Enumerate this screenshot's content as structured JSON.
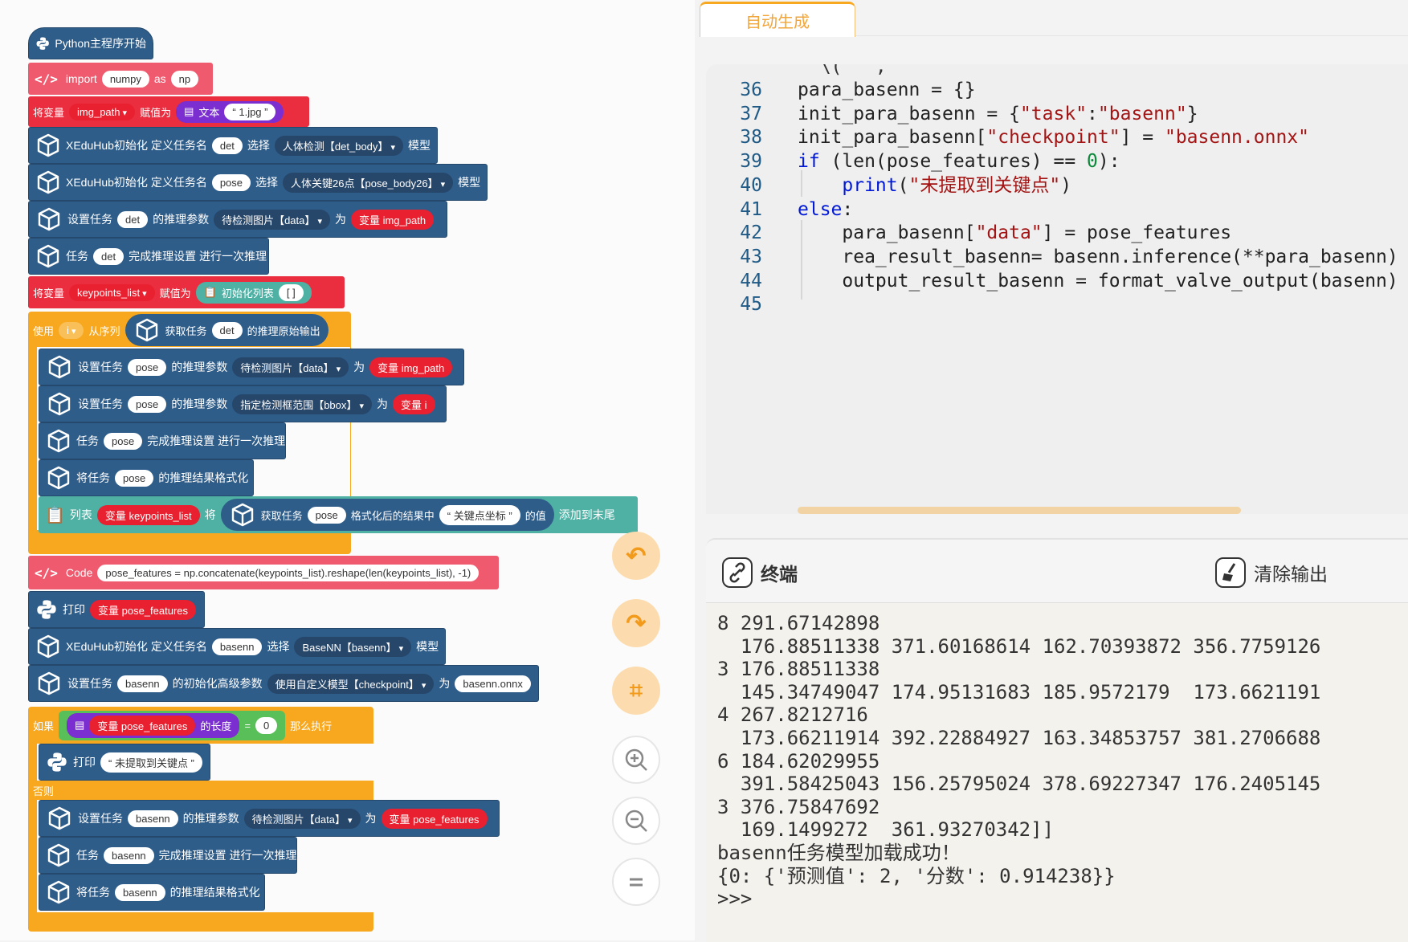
{
  "blocks": {
    "python_start": "Python主程序开始",
    "import": {
      "kw": "import",
      "module": "numpy",
      "as": "as",
      "alias": "np"
    },
    "assign_img": {
      "label1": "将变量",
      "var": "img_path",
      "label2": "赋值为",
      "text_label": "文本",
      "value": "“ 1.jpg ”"
    },
    "init_det": {
      "label": "XEduHub初始化 定义任务名",
      "name": "det",
      "select": "选择",
      "model": "人体检测【det_body】",
      "model_label": "模型"
    },
    "init_pose": {
      "label": "XEduHub初始化 定义任务名",
      "name": "pose",
      "select": "选择",
      "model": "人体关键26点【pose_body26】",
      "model_label": "模型"
    },
    "set_det": {
      "label1": "设置任务",
      "name": "det",
      "label2": "的推理参数",
      "param": "待检测图片【data】",
      "label3": "为",
      "value": "变量 img_path"
    },
    "run_det": {
      "label1": "任务",
      "name": "det",
      "label2": "完成推理设置 进行一次推理"
    },
    "assign_kp": {
      "label1": "将变量",
      "var": "keypoints_list",
      "label2": "赋值为",
      "init": "初始化列表",
      "value": "[ ]"
    },
    "loop": {
      "use": "使用",
      "var": "i",
      "from": "从序列",
      "label1": "获取任务",
      "name": "det",
      "label2": "的推理原始输出"
    },
    "set_pose_data": {
      "label1": "设置任务",
      "name": "pose",
      "label2": "的推理参数",
      "param": "待检测图片【data】",
      "label3": "为",
      "value": "变量 img_path"
    },
    "set_pose_bbox": {
      "label1": "设置任务",
      "name": "pose",
      "label2": "的推理参数",
      "param": "指定检测框范围【bbox】",
      "label3": "为",
      "value": "变量 i"
    },
    "run_pose": {
      "label1": "任务",
      "name": "pose",
      "label2": "完成推理设置 进行一次推理"
    },
    "format_pose": {
      "label1": "将任务",
      "name": "pose",
      "label2": "的推理结果格式化"
    },
    "append": {
      "list": "列表",
      "var": "变量 keypoints_list",
      "will": "将",
      "label1": "获取任务",
      "name": "pose",
      "label2": "格式化后的结果中",
      "key": "“ 关键点坐标 ”",
      "label3": "的值",
      "label4": "添加到末尾"
    },
    "code": {
      "kw": "Code",
      "text": "pose_features = np.concatenate(keypoints_list).reshape(len(keypoints_list), -1)"
    },
    "print_pf": {
      "label": "打印",
      "value": "变量 pose_features"
    },
    "init_basenn": {
      "label": "XEduHub初始化 定义任务名",
      "name": "basenn",
      "select": "选择",
      "model": "BaseNN【basenn】",
      "model_label": "模型"
    },
    "set_basenn_ckpt": {
      "label1": "设置任务",
      "name": "basenn",
      "label2": "的初始化高级参数",
      "param": "使用自定义模型【checkpoint】",
      "label3": "为",
      "value": "basenn.onnx"
    },
    "if": {
      "label": "如果",
      "var": "变量 pose_features",
      "len": "的长度",
      "eq": "=",
      "value": "0",
      "then": "那么执行"
    },
    "print_none": {
      "label": "打印",
      "value": "“ 未提取到关键点 ”"
    },
    "else": "否则",
    "set_basenn_data": {
      "label1": "设置任务",
      "name": "basenn",
      "label2": "的推理参数",
      "param": "待检测图片【data】",
      "label3": "为",
      "value": "变量 pose_features"
    },
    "run_basenn": {
      "label1": "任务",
      "name": "basenn",
      "label2": "完成推理设置 进行一次推理"
    },
    "format_basenn": {
      "label1": "将任务",
      "name": "basenn",
      "label2": "的推理结果格式化"
    }
  },
  "tab": {
    "label": "自动生成"
  },
  "code_lines": [
    {
      "n": "36",
      "segs": [
        [
          "",
          "para_basenn = {}"
        ]
      ]
    },
    {
      "n": "37",
      "segs": [
        [
          "",
          "init_para_basenn = {"
        ],
        [
          "str",
          "\"task\""
        ],
        [
          "",
          ":"
        ],
        [
          "str",
          "\"basenn\""
        ],
        [
          "",
          "}"
        ]
      ]
    },
    {
      "n": "38",
      "segs": [
        [
          "",
          "init_para_basenn["
        ],
        [
          "str",
          "\"checkpoint\""
        ],
        [
          "",
          "] = "
        ],
        [
          "str",
          "\"basenn.onnx\""
        ]
      ]
    },
    {
      "n": "39",
      "segs": [
        [
          "kw",
          "if"
        ],
        [
          "",
          " (len(pose_features) == "
        ],
        [
          "num",
          "0"
        ],
        [
          "",
          "):"
        ]
      ]
    },
    {
      "n": "40",
      "segs": [
        [
          "",
          "    "
        ],
        [
          "kw",
          "print"
        ],
        [
          "",
          "("
        ],
        [
          "str",
          "\"未提取到关键点\""
        ],
        [
          "",
          ")"
        ]
      ]
    },
    {
      "n": "41",
      "segs": [
        [
          "kw",
          "else"
        ],
        [
          "",
          ":"
        ]
      ]
    },
    {
      "n": "42",
      "segs": [
        [
          "",
          "    para_basenn["
        ],
        [
          "str",
          "\"data\""
        ],
        [
          "",
          "] = pose_features"
        ]
      ]
    },
    {
      "n": "43",
      "segs": [
        [
          "",
          "    rea_result_basenn= basenn.inference(**para_basenn)"
        ]
      ]
    },
    {
      "n": "44",
      "segs": [
        [
          "",
          "    output_result_basenn = format_valve_output(basenn)"
        ]
      ]
    },
    {
      "n": "45",
      "segs": [
        [
          "",
          ""
        ]
      ]
    }
  ],
  "terminal": {
    "title": "终端",
    "clear_label": "清除输出",
    "lines": [
      "8 291.67142898",
      "  176.88511338 371.60168614 162.70393872 356.7759126",
      "3 176.88511338",
      "  145.34749047 174.95131683 185.9572179  173.6621191",
      "4 267.8212716",
      "  173.66211914 392.22884927 163.34853757 381.2706688",
      "6 184.62029955",
      "  391.58425043 156.25795024 378.69227347 176.2405145",
      "3 376.75847692",
      "  169.1499272  361.93270342]]",
      "basenn任务模型加载成功！",
      "{0: {'预测值': 2, '分数': 0.914238}}",
      ">>>"
    ]
  },
  "colors": {
    "block_blue": "#2f5d8a",
    "block_red": "#ea2d3f",
    "block_orange": "#f7a81f",
    "accent": "#f7a81f"
  },
  "controls": [
    "undo-icon",
    "redo-icon",
    "crop-icon",
    "zoom-in-icon",
    "zoom-out-icon",
    "reset-zoom-icon"
  ]
}
